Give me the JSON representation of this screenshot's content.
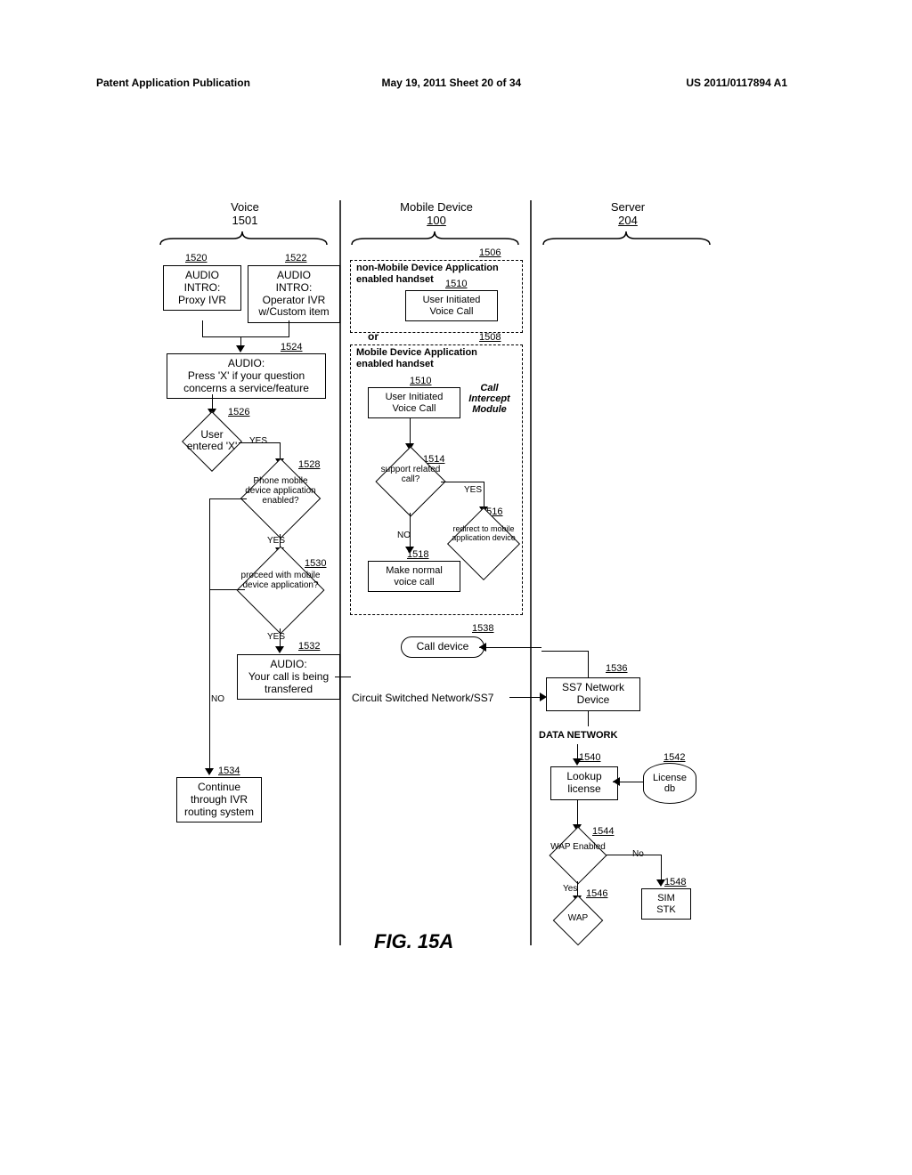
{
  "header": {
    "left": "Patent Application Publication",
    "center": "May 19, 2011  Sheet 20 of 34",
    "right": "US 2011/0117894 A1"
  },
  "lanes": {
    "voice": "Voice",
    "voiceNum": "1501",
    "mobile": "Mobile Device",
    "mobileNum": "100",
    "server": "Server",
    "serverNum": "204"
  },
  "refs": {
    "r1520": "1520",
    "r1522": "1522",
    "r1524": "1524",
    "r1526": "1526",
    "r1528": "1528",
    "r1530": "1530",
    "r1532": "1532",
    "r1534": "1534",
    "r1506": "1506",
    "r1508": "1508",
    "r1510a": "1510",
    "r1510b": "1510",
    "r1514": "1514",
    "r1516": "1516",
    "r1518": "1518",
    "r1538": "1538",
    "r1536": "1536",
    "r1540": "1540",
    "r1542": "1542",
    "r1544": "1544",
    "r1546": "1546",
    "r1548": "1548"
  },
  "boxes": {
    "b1520": "AUDIO\nINTRO:\nProxy IVR",
    "b1522": "AUDIO\nINTRO:\nOperator IVR\nw/Custom item",
    "b1524": "AUDIO:\nPress 'X' if your question\nconcerns a service/feature",
    "b1532": "AUDIO:\nYour call is being\ntransfered",
    "b1534": "Continue\nthrough IVR\nrouting system",
    "b1506": "non-Mobile Device Application\nenabled handset",
    "b1508": "Mobile Device Application\nenabled handset",
    "b1510": "User Initiated\nVoice Call",
    "b1518": "Make normal\nvoice call",
    "intercept": "Call\nIntercept\nModule",
    "b1538": "Call device",
    "ss7": "Circuit Switched Network/SS7",
    "b1536": "SS7 Network\nDevice",
    "dataNet": "DATA NETWORK",
    "b1540": "Lookup\nlicense",
    "b1542": "License\ndb",
    "b1546": "WAP",
    "b1548": "SIM\nSTK",
    "or": "or"
  },
  "decisions": {
    "d1526": "User\nentered 'X'",
    "d1528": "Phone\nmobile device\napplication\nenabled?",
    "d1530": "proceed\nwith mobile device\napplication?",
    "d1514": "support\nrelated\ncall?",
    "d1516": "redirect to\nmobile\napplication\ndevice",
    "d1544": "WAP\nEnabled"
  },
  "edges": {
    "yes": "YES",
    "no": "NO",
    "yes2": "Yes",
    "no2": "No"
  },
  "figure": "FIG. 15A",
  "chart_data": {
    "type": "flowchart",
    "title": "FIG. 15A — Voice / Mobile Device / Server call-intercept flow",
    "swimlanes": [
      {
        "id": "voice",
        "label": "Voice",
        "ref": "1501"
      },
      {
        "id": "mobile",
        "label": "Mobile Device",
        "ref": "100"
      },
      {
        "id": "server",
        "label": "Server",
        "ref": "204"
      }
    ],
    "nodes": [
      {
        "id": "1520",
        "lane": "voice",
        "type": "process",
        "text": "AUDIO INTRO: Proxy IVR"
      },
      {
        "id": "1522",
        "lane": "voice",
        "type": "process",
        "text": "AUDIO INTRO: Operator IVR w/Custom item"
      },
      {
        "id": "1524",
        "lane": "voice",
        "type": "process",
        "text": "AUDIO: Press 'X' if your question concerns a service/feature"
      },
      {
        "id": "1526",
        "lane": "voice",
        "type": "decision",
        "text": "User entered 'X'"
      },
      {
        "id": "1528",
        "lane": "voice",
        "type": "decision",
        "text": "Phone mobile device application enabled?"
      },
      {
        "id": "1530",
        "lane": "voice",
        "type": "decision",
        "text": "proceed with mobile device application?"
      },
      {
        "id": "1532",
        "lane": "voice",
        "type": "process",
        "text": "AUDIO: Your call is being transfered"
      },
      {
        "id": "1534",
        "lane": "voice",
        "type": "process",
        "text": "Continue through IVR routing system"
      },
      {
        "id": "1506",
        "lane": "mobile",
        "type": "group-dashed",
        "text": "non-Mobile Device Application enabled handset"
      },
      {
        "id": "1508",
        "lane": "mobile",
        "type": "group-dashed",
        "text": "Mobile Device Application enabled handset"
      },
      {
        "id": "1510a",
        "lane": "mobile",
        "parent": "1506",
        "type": "process",
        "text": "User Initiated Voice Call"
      },
      {
        "id": "1510b",
        "lane": "mobile",
        "parent": "1508",
        "type": "process",
        "text": "User Initiated Voice Call"
      },
      {
        "id": "intercept",
        "lane": "mobile",
        "parent": "1508",
        "type": "label",
        "text": "Call Intercept Module"
      },
      {
        "id": "1514",
        "lane": "mobile",
        "parent": "1508",
        "type": "decision",
        "text": "support related call?"
      },
      {
        "id": "1516",
        "lane": "mobile",
        "parent": "1508",
        "type": "decision",
        "text": "redirect to mobile application device"
      },
      {
        "id": "1518",
        "lane": "mobile",
        "parent": "1508",
        "type": "process",
        "text": "Make normal voice call"
      },
      {
        "id": "1538",
        "lane": "mobile",
        "type": "process-rounded",
        "text": "Call device"
      },
      {
        "id": "ss7",
        "lane": "mobile",
        "type": "label",
        "text": "Circuit Switched Network/SS7"
      },
      {
        "id": "1536",
        "lane": "server",
        "type": "process",
        "text": "SS7 Network Device"
      },
      {
        "id": "datanet",
        "lane": "server",
        "type": "label",
        "text": "DATA NETWORK"
      },
      {
        "id": "1540",
        "lane": "server",
        "type": "process",
        "text": "Lookup license"
      },
      {
        "id": "1542",
        "lane": "server",
        "type": "datastore",
        "text": "License db"
      },
      {
        "id": "1544",
        "lane": "server",
        "type": "decision",
        "text": "WAP Enabled"
      },
      {
        "id": "1546",
        "lane": "server",
        "type": "decision",
        "text": "WAP"
      },
      {
        "id": "1548",
        "lane": "server",
        "type": "process",
        "text": "SIM STK"
      }
    ],
    "edges": [
      {
        "from": "1520",
        "to": "1524"
      },
      {
        "from": "1522",
        "to": "1524"
      },
      {
        "from": "1524",
        "to": "1526"
      },
      {
        "from": "1526",
        "to": "1528",
        "label": "YES"
      },
      {
        "from": "1526",
        "to": "1534",
        "label": "NO (implied)"
      },
      {
        "from": "1528",
        "to": "1530",
        "label": "YES"
      },
      {
        "from": "1528",
        "to": "1534",
        "label": "NO"
      },
      {
        "from": "1530",
        "to": "1532",
        "label": "YES"
      },
      {
        "from": "1530",
        "to": "1534",
        "label": "NO"
      },
      {
        "from": "1532",
        "to": "ss7"
      },
      {
        "from": "1506",
        "to": "1508",
        "label": "or"
      },
      {
        "from": "1510b",
        "to": "1514"
      },
      {
        "from": "1514",
        "to": "1516",
        "label": "YES"
      },
      {
        "from": "1514",
        "to": "1518",
        "label": "NO"
      },
      {
        "from": "ss7",
        "to": "1536"
      },
      {
        "from": "1536",
        "to": "1538"
      },
      {
        "from": "1536",
        "to": "datanet"
      },
      {
        "from": "datanet",
        "to": "1540"
      },
      {
        "from": "1542",
        "to": "1540"
      },
      {
        "from": "1540",
        "to": "1544"
      },
      {
        "from": "1544",
        "to": "1546",
        "label": "Yes"
      },
      {
        "from": "1544",
        "to": "1548",
        "label": "No"
      }
    ]
  }
}
